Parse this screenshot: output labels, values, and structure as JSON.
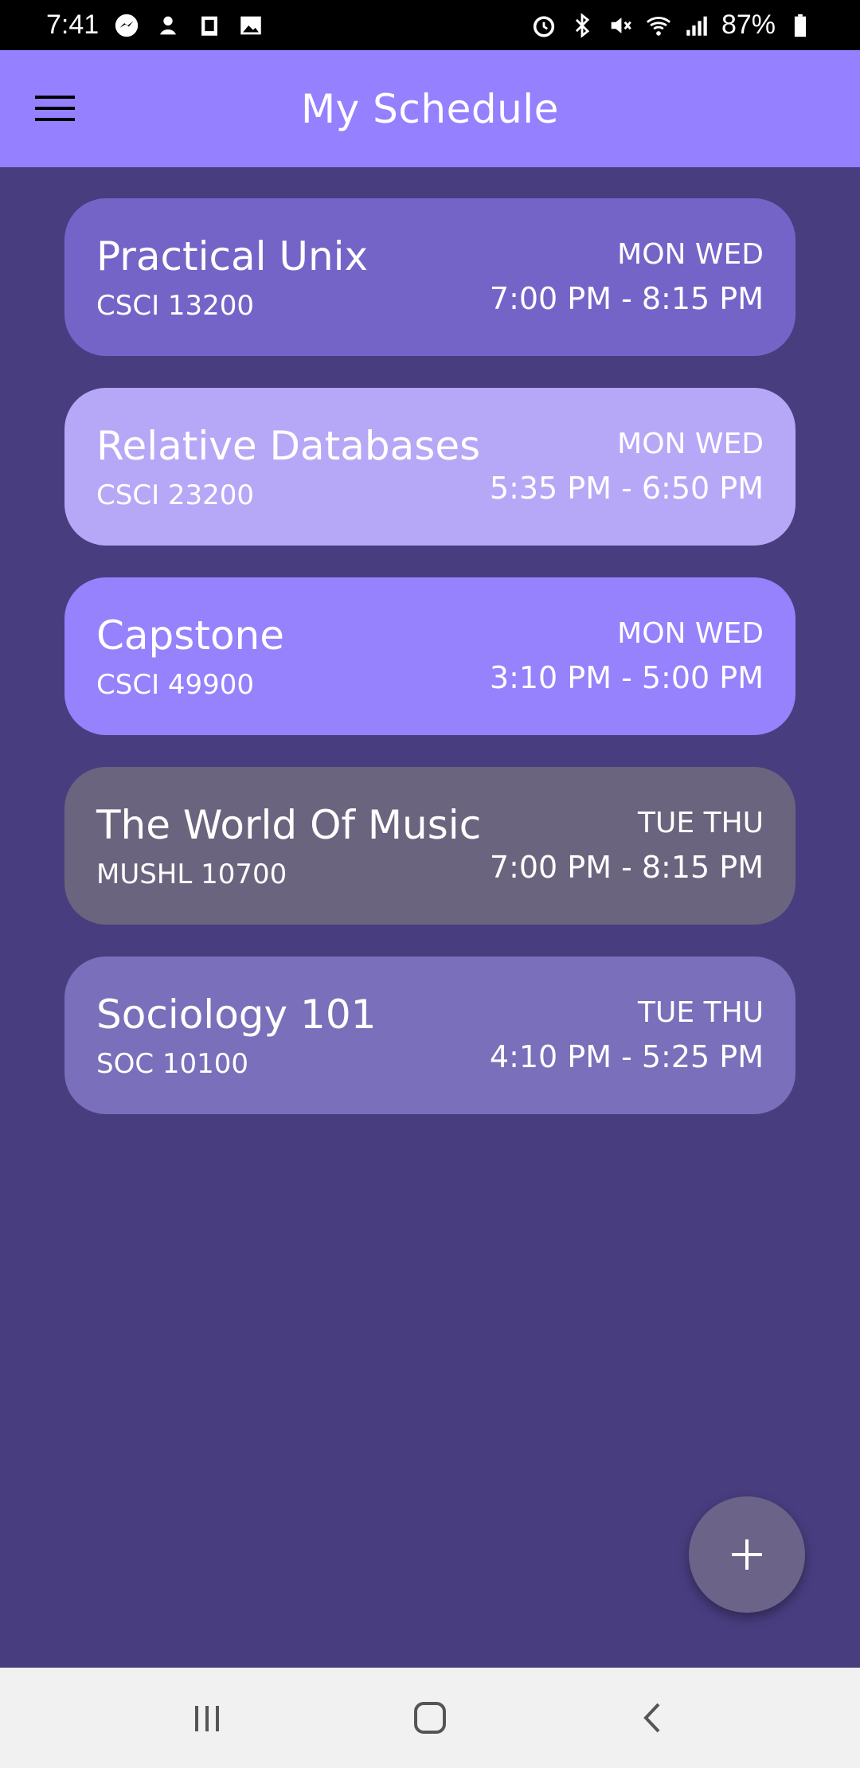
{
  "status_bar": {
    "time": "7:41",
    "battery": "87%",
    "left_icons": [
      "messenger-icon",
      "notification-icon",
      "clipboard-icon",
      "image-icon"
    ],
    "right_icons": [
      "alarm-icon",
      "bluetooth-icon",
      "mute-icon",
      "wifi-icon",
      "signal-icon",
      "battery-icon"
    ]
  },
  "app_bar": {
    "title": "My Schedule",
    "menu_icon": "hamburger-menu-icon",
    "color": "#9580ff"
  },
  "courses": [
    {
      "name": "Practical Unix",
      "code": "CSCI 13200",
      "days": "MON WED",
      "time": "7:00 PM - 8:15 PM",
      "color": "#7564c8"
    },
    {
      "name": "Relative Databases",
      "code": "CSCI 23200",
      "days": "MON WED",
      "time": "5:35 PM - 6:50 PM",
      "color": "#b7a8f7"
    },
    {
      "name": "Capstone",
      "code": "CSCI 49900",
      "days": "MON WED",
      "time": "3:10 PM - 5:00 PM",
      "color": "#9582fc"
    },
    {
      "name": "The World Of Music",
      "code": "MUSHL 10700",
      "days": "TUE THU",
      "time": "7:00 PM - 8:15 PM",
      "color": "#6b647e"
    },
    {
      "name": "Sociology 101",
      "code": "SOC 10100",
      "days": "TUE THU",
      "time": "4:10 PM - 5:25 PM",
      "color": "#7a6fba"
    }
  ],
  "fab": {
    "icon": "plus-icon",
    "color": "#6c6488"
  },
  "background_color": "#483d7f",
  "nav_bar": {
    "icons": [
      "recent-apps-icon",
      "home-icon",
      "back-icon"
    ]
  }
}
